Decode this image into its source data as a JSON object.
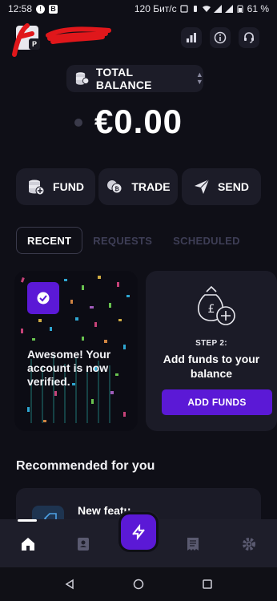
{
  "status_bar": {
    "time": "12:58",
    "network": "120 Бит/с",
    "battery": "61 %"
  },
  "header": {
    "profile_badge": "P"
  },
  "balance": {
    "selector_label": "TOTAL BALANCE",
    "amount": "€0.00"
  },
  "actions": {
    "fund": "FUND",
    "trade": "TRADE",
    "send": "SEND"
  },
  "tabs": {
    "recent": "RECENT",
    "requests": "REQUESTS",
    "scheduled": "SCHEDULED"
  },
  "cards": {
    "verified_text": "Awesome! Your account is now verified.",
    "step_label": "STEP 2:",
    "step_title": "Add funds to your balance",
    "add_funds_button": "ADD FUNDS"
  },
  "recommended": {
    "title": "Recommended for you",
    "item_label": "New featu"
  },
  "colors": {
    "background": "#0f0f17",
    "surface": "#1c1c28",
    "accent": "#5b19d6"
  }
}
